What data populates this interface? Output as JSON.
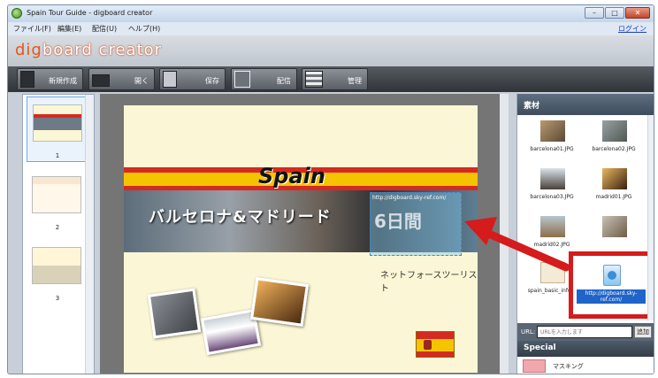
{
  "window": {
    "title": "Spain Tour Guide - digboard creator"
  },
  "menu": [
    "ファイル(F)",
    "編集(E)",
    "配信(U)",
    "ヘルプ(H)"
  ],
  "login": "ログイン",
  "logo": {
    "prefix": "dig",
    "rest": "board creator"
  },
  "toolbar": [
    {
      "label": "新規作成",
      "icon": "new-document-icon"
    },
    {
      "label": "開く",
      "icon": "folder-icon"
    },
    {
      "label": "保存",
      "icon": "save-icon"
    },
    {
      "label": "配信",
      "icon": "monitor-icon"
    },
    {
      "label": "管理",
      "icon": "list-icon"
    }
  ],
  "slides": [
    "1",
    "2",
    "3"
  ],
  "slide": {
    "title": "Spain",
    "banner": "バルセロナ&マドリード",
    "url": "http://digboard.sky-ref.com/",
    "days": "6日間",
    "agency": "ネットフォースツーリスト"
  },
  "sidebar": {
    "title": "素材",
    "assets": [
      "barcelona01.JPG",
      "barcelona02.JPG",
      "barcelona03.JPG",
      "madrid01.JPG",
      "madrid02.JPG",
      "",
      "spain_basic_info..."
    ],
    "web_item": "http://digboard.sky-ref.com/",
    "url_label": "URL:",
    "url_placeholder": "URLを入力します",
    "add_button": "追加",
    "special_title": "Special",
    "special_item": "マスキング"
  },
  "colors": {
    "accent": "#d51b1b",
    "selection": "#1f64c8",
    "logo": "#e5551d"
  }
}
